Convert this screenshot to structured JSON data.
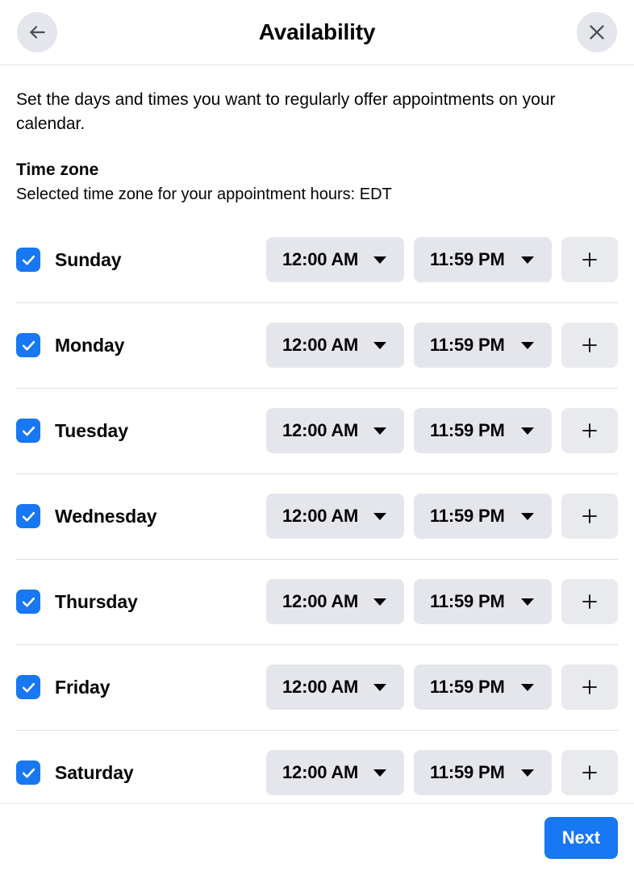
{
  "header": {
    "title": "Availability",
    "back_icon": "arrow-left-icon",
    "close_icon": "close-icon"
  },
  "body": {
    "intro": "Set the days and times you want to regularly offer appointments on your calendar.",
    "timezone_heading": "Time zone",
    "timezone_subtext": "Selected time zone for your appointment hours: EDT",
    "timezone_code": "EDT"
  },
  "days": [
    {
      "label": "Sunday",
      "checked": true,
      "start": "12:00 AM",
      "end": "11:59 PM",
      "add_label": "+"
    },
    {
      "label": "Monday",
      "checked": true,
      "start": "12:00 AM",
      "end": "11:59 PM",
      "add_label": "+"
    },
    {
      "label": "Tuesday",
      "checked": true,
      "start": "12:00 AM",
      "end": "11:59 PM",
      "add_label": "+"
    },
    {
      "label": "Wednesday",
      "checked": true,
      "start": "12:00 AM",
      "end": "11:59 PM",
      "add_label": "+"
    },
    {
      "label": "Thursday",
      "checked": true,
      "start": "12:00 AM",
      "end": "11:59 PM",
      "add_label": "+"
    },
    {
      "label": "Friday",
      "checked": true,
      "start": "12:00 AM",
      "end": "11:59 PM",
      "add_label": "+"
    },
    {
      "label": "Saturday",
      "checked": true,
      "start": "12:00 AM",
      "end": "11:59 PM",
      "add_label": "+"
    }
  ],
  "footer": {
    "next_label": "Next"
  },
  "colors": {
    "accent": "#1877f2",
    "control_bg": "#e4e6eb",
    "divider": "#dcdee3",
    "text": "#050505",
    "page_bg": "#ffffff"
  }
}
